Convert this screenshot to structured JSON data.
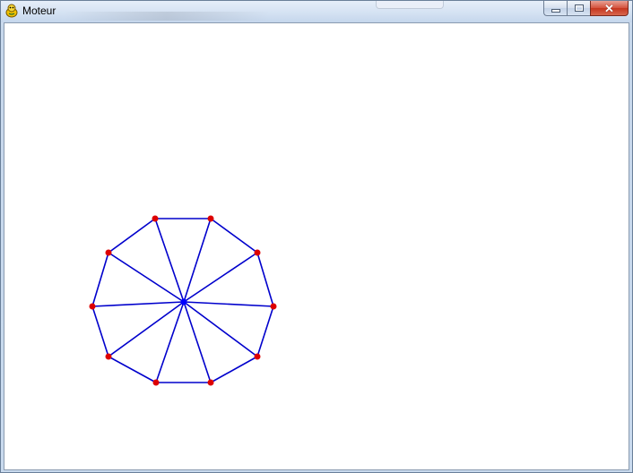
{
  "window": {
    "title": "Moteur",
    "app_icon": "pygame-snake-icon",
    "controls": {
      "minimize_icon": "minimize-icon",
      "maximize_icon": "maximize-icon",
      "close_icon": "close-icon",
      "close_glyph": "✕"
    }
  },
  "canvas": {
    "background": "#ffffff",
    "edge_color": "#0000cc",
    "vertex_color": "#dd0000",
    "center_color": "#0000ff",
    "vertex_count": 10
  }
}
